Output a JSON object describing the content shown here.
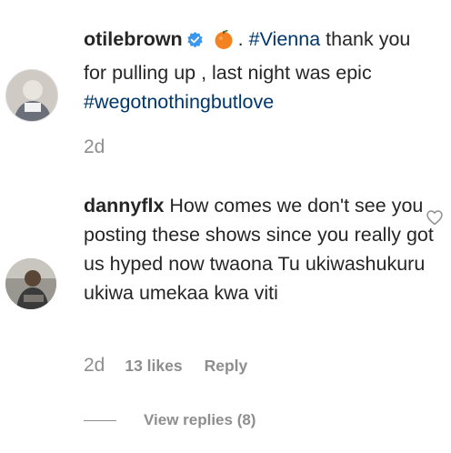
{
  "caption": {
    "username": "otilebrown",
    "separator": ".",
    "hashtag1": "#Vienna",
    "text": "thank you for pulling up , last night was epic",
    "hashtag2": "#wegotnothingbutlove",
    "time": "2d"
  },
  "comment": {
    "username": "dannyflx",
    "text": "How comes we don't see you posting these shows since you really got us hyped now twaona Tu ukiwashukuru ukiwa umekaa kwa viti",
    "time": "2d",
    "likes": "13 likes",
    "reply_label": "Reply",
    "view_replies": "View replies (8)"
  },
  "icons": {
    "verified": "verified-badge-icon",
    "emoji": "orange-emoji-icon",
    "like": "heart-outline-icon"
  },
  "colors": {
    "verified_blue": "#3897f0",
    "hashtag": "#00376b",
    "meta_gray": "#8e8e8e"
  }
}
